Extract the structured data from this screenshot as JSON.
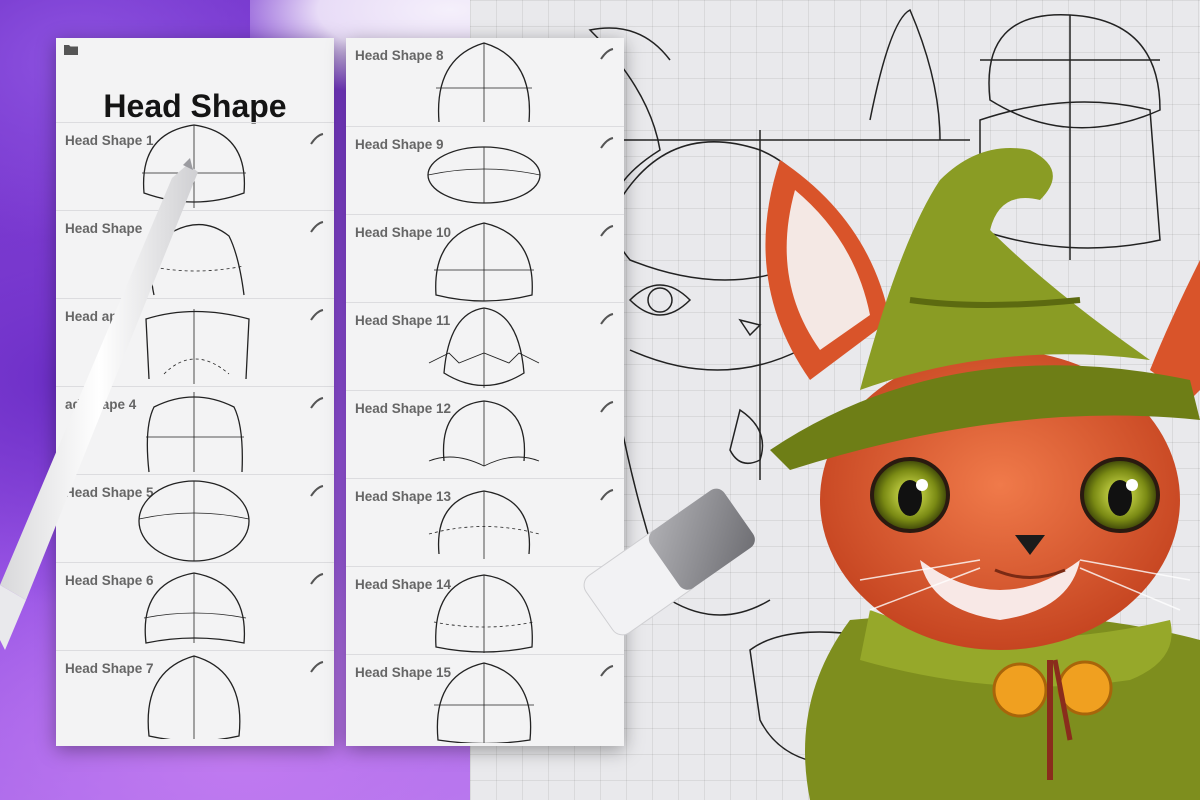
{
  "panel_title": "Head Shape",
  "left_items": [
    {
      "label": "Head Shape 1"
    },
    {
      "label": "Head Shape"
    },
    {
      "label": "Head    ape 3"
    },
    {
      "label": "    ad Shape 4"
    },
    {
      "label": "Head Shape 5"
    },
    {
      "label": "Head Shape 6"
    },
    {
      "label": "Head Shape 7"
    }
  ],
  "right_items": [
    {
      "label": "Head Shape 8"
    },
    {
      "label": "Head Shape 9"
    },
    {
      "label": "Head Shape 10"
    },
    {
      "label": "Head Shape 11"
    },
    {
      "label": "Head Shape 12"
    },
    {
      "label": "Head Shape 13"
    },
    {
      "label": "Head Shape 14"
    },
    {
      "label": "Head Shape 15"
    }
  ],
  "icons": {
    "folder": "folder-icon",
    "brush": "brush-stroke-icon"
  },
  "colors": {
    "background_purple": "#7a3fd0",
    "panel_bg": "#f3f3f4",
    "label": "#666666",
    "title": "#141414",
    "hat_green": "#7a8a22",
    "fox_orange": "#d9542a"
  }
}
